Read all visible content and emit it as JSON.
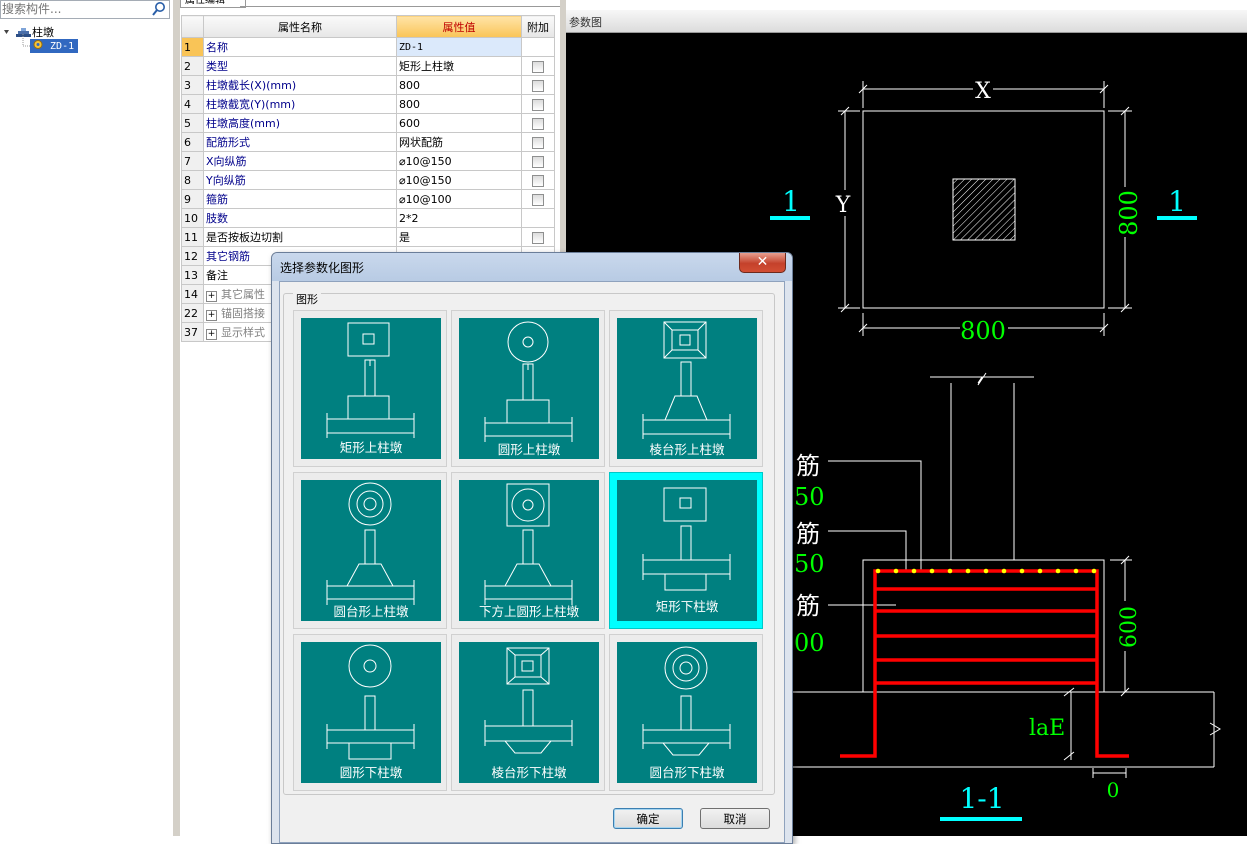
{
  "tree": {
    "search_placeholder": "搜索构件...",
    "root_label": "柱墩",
    "child_label": "ZD-1"
  },
  "props": {
    "tab_label": "属性编辑",
    "headers": {
      "name": "属性名称",
      "value": "属性值",
      "extra": "附加"
    },
    "rows": [
      {
        "num": "1",
        "name": "名称",
        "value": "ZD-1",
        "check": false
      },
      {
        "num": "2",
        "name": "类型",
        "value": "矩形上柱墩",
        "check": true
      },
      {
        "num": "3",
        "name": "柱墩截长(X)(mm)",
        "value": "800",
        "check": true
      },
      {
        "num": "4",
        "name": "柱墩截宽(Y)(mm)",
        "value": "800",
        "check": true
      },
      {
        "num": "5",
        "name": "柱墩高度(mm)",
        "value": "600",
        "check": true
      },
      {
        "num": "6",
        "name": "配筋形式",
        "value": "网状配筋",
        "check": true
      },
      {
        "num": "7",
        "name": "X向纵筋",
        "value": "⌀10@150",
        "check": true
      },
      {
        "num": "8",
        "name": "Y向纵筋",
        "value": "⌀10@150",
        "check": true
      },
      {
        "num": "9",
        "name": "箍筋",
        "value": "⌀10@100",
        "check": true
      },
      {
        "num": "10",
        "name": "肢数",
        "value": "2*2",
        "check": false
      },
      {
        "num": "11",
        "name": "是否按板边切割",
        "value": "是",
        "check": true
      },
      {
        "num": "12",
        "name": "其它钢筋",
        "value": "",
        "check": false
      },
      {
        "num": "13",
        "name": "备注",
        "value": "",
        "check": false
      },
      {
        "num": "14",
        "name": "其它属性",
        "value": "",
        "check": false
      },
      {
        "num": "22",
        "name": "锚固搭接",
        "value": "",
        "check": false
      },
      {
        "num": "37",
        "name": "显示样式",
        "value": "",
        "check": false
      }
    ]
  },
  "param_view": {
    "title": "参数图",
    "plan": {
      "x_label": "X",
      "y_label": "Y",
      "dim_bottom": "800",
      "dim_right": "800",
      "section_mark": "1"
    },
    "section": {
      "labels": [
        "筋",
        "50",
        "筋",
        "50",
        "筋",
        "00"
      ],
      "dim_height": "600",
      "anchor": "laE",
      "dim_bottom": "0",
      "title": "1-1"
    }
  },
  "dialog": {
    "title": "选择参数化图形",
    "group_label": "图形",
    "shapes": [
      {
        "label": "矩形上柱墩"
      },
      {
        "label": "圆形上柱墩"
      },
      {
        "label": "棱台形上柱墩"
      },
      {
        "label": "圆台形上柱墩"
      },
      {
        "label": "下方上圆形上柱墩"
      },
      {
        "label": "矩形下柱墩"
      },
      {
        "label": "圆形下柱墩"
      },
      {
        "label": "棱台形下柱墩"
      },
      {
        "label": "圆台形下柱墩"
      }
    ],
    "selected_shape": "矩形下柱墩",
    "ok_label": "确定",
    "cancel_label": "取消"
  },
  "colors": {
    "teal": "#008080",
    "selected": "#00ffff",
    "cad_green": "#00ff00",
    "cad_cyan": "#00ffff",
    "rebar_red": "#ff0000"
  }
}
